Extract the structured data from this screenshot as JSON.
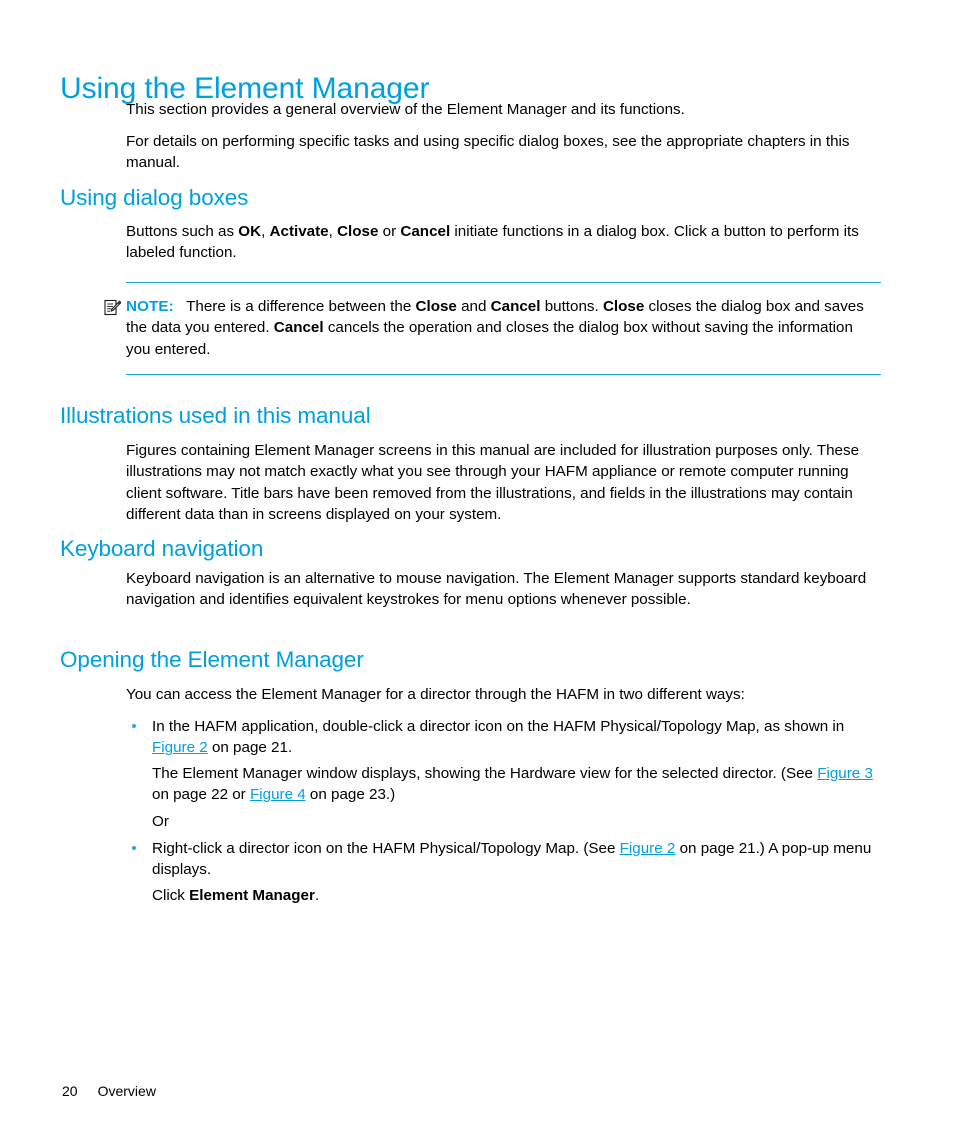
{
  "document": {
    "title": "Using the Element Manager",
    "intro_paragraphs": [
      "This section provides a general overview of the Element Manager and its functions.",
      "For details on performing specific tasks and using specific dialog boxes, see the appropriate chapters in this manual."
    ]
  },
  "sections": {
    "dialog_boxes": {
      "heading": "Using dialog boxes",
      "para_1a": "Buttons such as ",
      "btn_ok": "OK",
      "sep_1": ", ",
      "btn_activate": "Activate",
      "sep_2": ", ",
      "btn_close": "Close",
      "sep_3": " or ",
      "btn_cancel": "Cancel",
      "para_1b": " initiate functions in a dialog box. Click a button to perform its labeled function."
    },
    "note": {
      "icon": "note-pencil-icon",
      "label": "NOTE:",
      "t1": "There is a difference between the ",
      "b1": "Close",
      "t2": " and ",
      "b2": "Cancel",
      "t3": " buttons. ",
      "b3": "Close",
      "t4": " closes the dialog box and saves the data you entered. ",
      "b4": "Cancel",
      "t5": " cancels the operation and closes the dialog box without saving the information you entered."
    },
    "illustrations": {
      "heading": "Illustrations used in this manual",
      "body": "Figures containing Element Manager screens in this manual are included for illustration purposes only. These illustrations may not match exactly what you see through your HAFM appliance or remote computer running client software. Title bars have been removed from the illustrations, and fields in the illustrations may contain different data than in screens displayed on your system."
    },
    "keyboard": {
      "heading": "Keyboard navigation",
      "body": "Keyboard navigation is an alternative to mouse navigation. The Element Manager supports standard keyboard navigation and identifies equivalent keystrokes for menu options whenever possible."
    },
    "opening": {
      "heading": "Opening the Element Manager",
      "lead": "You can access the Element Manager for a director through the HAFM in two different ways:",
      "bullet_1": {
        "t1": "In the HAFM application, double-click a director icon on the HAFM Physical/Topology Map, as shown in ",
        "link1": "Figure 2",
        "t2": " on page 21."
      },
      "sub_1": {
        "t1": "The Element Manager window displays, showing the Hardware view for the selected director. (See ",
        "link1": "Figure 3",
        "t2": " on page 22 or ",
        "link2": "Figure 4",
        "t3": " on page 23.)"
      },
      "or_text": "Or",
      "bullet_2": {
        "t1": "Right-click a director icon on the HAFM Physical/Topology Map. (See ",
        "link1": "Figure 2",
        "t2": " on page 21.) A pop-up menu displays."
      },
      "sub_2": {
        "t1": "Click ",
        "b1": "Element Manager",
        "t2": "."
      }
    }
  },
  "footer": {
    "page_number": "20",
    "section_name": "Overview"
  },
  "colors": {
    "heading_blue": "#00A0DF",
    "link_blue": "#00A0DF",
    "rule_blue": "#1AA7DC",
    "bullet_blue": "#2AA8DE",
    "text_black": "#000000",
    "page_background": "#FFFFFF"
  }
}
